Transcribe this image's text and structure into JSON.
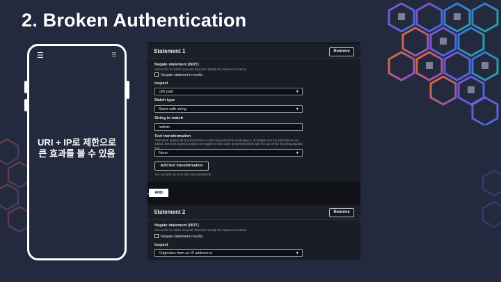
{
  "slide": {
    "title": "2. Broken Authentication"
  },
  "phone": {
    "menu_icon": "☰",
    "grid_icon": "⠿",
    "caption_line1": "URI + IP로 제한으로",
    "caption_line2": "큰 효과를 볼 수 있음"
  },
  "statement1": {
    "title": "Statement 1",
    "remove_label": "Remove",
    "negate_label": "Negate statement (NOT)",
    "negate_desc": "Select this to match requests that don't satisfy the statement criteria.",
    "negate_checkbox_label": "Negate statement results",
    "inspect_label": "Inspect",
    "inspect_value": "URI path",
    "match_type_label": "Match type",
    "match_type_value": "Starts with string",
    "string_label": "String to match",
    "string_value": "/admin",
    "transform_label": "Text transformation",
    "transform_desc": "AWS WAF applies all transformations to the request before evaluating it. If multiple text transformations are added, then text transformations are applied in the order presented below with the top of the list being applied first.",
    "transform_value": "None",
    "add_transform_label": "Add text transformation",
    "add_transform_hint": "You can add up to 10 text transformations."
  },
  "and_label": "AND",
  "statement2": {
    "title": "Statement 2",
    "remove_label": "Remove",
    "negate_label": "Negate statement (NOT)",
    "negate_desc": "Select this to match requests that don't satisfy the statement criteria.",
    "negate_checkbox_label": "Negate statement results",
    "inspect_label": "Inspect",
    "inspect_value": "Originates from an IP address in"
  },
  "colors": {
    "background": "#232a3d",
    "console": "#101218",
    "hex_orange": "#e86a2c",
    "hex_purple": "#8a4fd1",
    "hex_blue": "#3b6fe0",
    "hex_teal": "#2aa5a0"
  }
}
